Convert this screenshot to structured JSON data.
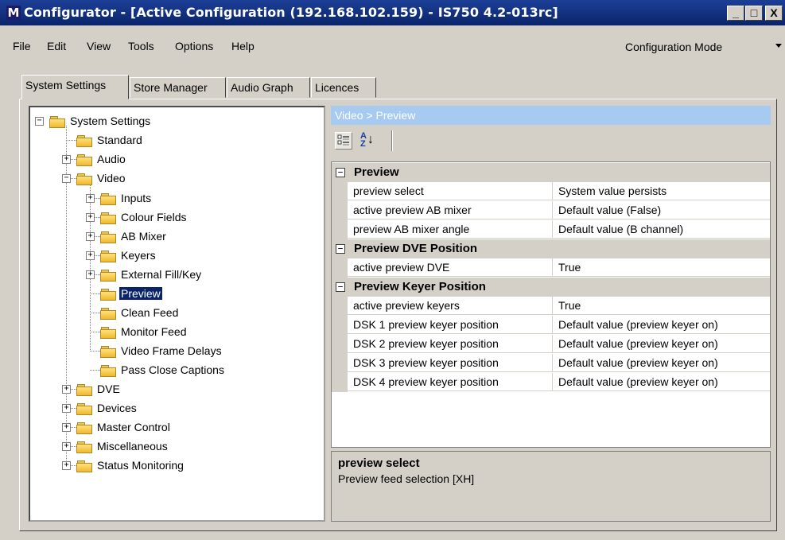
{
  "window": {
    "title": "Configurator - [Active Configuration (192.168.102.159) - IS750 4.2-013rc]",
    "logo_letter": "M",
    "buttons": {
      "minimize": "_",
      "maximize": "□",
      "close": "X"
    }
  },
  "menu": {
    "items": [
      "File",
      "Edit",
      "View",
      "Tools",
      "Options",
      "Help"
    ],
    "mode_select": "Configuration Mode"
  },
  "tabs": [
    "System Settings",
    "Store Manager",
    "Audio Graph",
    "Licences"
  ],
  "active_tab": "System Settings",
  "tree": {
    "items": [
      {
        "label": "System Settings",
        "expander": "−"
      },
      {
        "label": "Standard",
        "expander": ""
      },
      {
        "label": "Audio",
        "expander": "+"
      },
      {
        "label": "Video",
        "expander": "−"
      },
      {
        "label": "Inputs",
        "expander": "+"
      },
      {
        "label": "Colour Fields",
        "expander": "+"
      },
      {
        "label": "AB Mixer",
        "expander": "+"
      },
      {
        "label": "Keyers",
        "expander": "+"
      },
      {
        "label": "External Fill/Key",
        "expander": "+"
      },
      {
        "label": "Preview",
        "expander": "",
        "selected": true
      },
      {
        "label": "Clean Feed",
        "expander": ""
      },
      {
        "label": "Monitor Feed",
        "expander": ""
      },
      {
        "label": "Video Frame Delays",
        "expander": ""
      },
      {
        "label": "Pass Close Captions",
        "expander": ""
      },
      {
        "label": "DVE",
        "expander": "+"
      },
      {
        "label": "Devices",
        "expander": "+"
      },
      {
        "label": "Master Control",
        "expander": "+"
      },
      {
        "label": "Miscellaneous",
        "expander": "+"
      },
      {
        "label": "Status Monitoring",
        "expander": "+"
      }
    ]
  },
  "breadcrumb": "Video > Preview",
  "toolbar": {
    "categorized_icon": "categorized-view-icon",
    "alphabetical_icon": "alphabetical-sort-icon",
    "alpha_top": "A",
    "alpha_bottom": "Z",
    "alpha_arrow": "↓"
  },
  "property_grid": {
    "rows": [
      {
        "type": "category",
        "label": "Preview",
        "expander": "−"
      },
      {
        "type": "property",
        "name": "preview select",
        "value": "System value persists"
      },
      {
        "type": "property",
        "name": "active preview AB mixer",
        "value": "Default value (False)"
      },
      {
        "type": "property",
        "name": "preview AB mixer angle",
        "value": "Default value (B channel)"
      },
      {
        "type": "category",
        "label": "Preview DVE Position",
        "expander": "−"
      },
      {
        "type": "property",
        "name": "active preview DVE",
        "value": "True"
      },
      {
        "type": "category",
        "label": "Preview Keyer Position",
        "expander": "−"
      },
      {
        "type": "property",
        "name": "active preview keyers",
        "value": "True"
      },
      {
        "type": "property",
        "name": "DSK 1 preview keyer position",
        "value": "Default value (preview keyer on)"
      },
      {
        "type": "property",
        "name": "DSK 2 preview keyer position",
        "value": "Default value (preview keyer on)"
      },
      {
        "type": "property",
        "name": "DSK 3 preview keyer position",
        "value": "Default value (preview keyer on)"
      },
      {
        "type": "property",
        "name": "DSK 4 preview keyer position",
        "value": "Default value (preview keyer on)"
      }
    ]
  },
  "description": {
    "title": "preview select",
    "text": "Preview feed selection [XH]"
  },
  "colors": {
    "titlebar": "#0a246a",
    "breadcrumb_bar": "#a6caf0",
    "selection": "#0a246a",
    "face": "#d4d0c8"
  }
}
